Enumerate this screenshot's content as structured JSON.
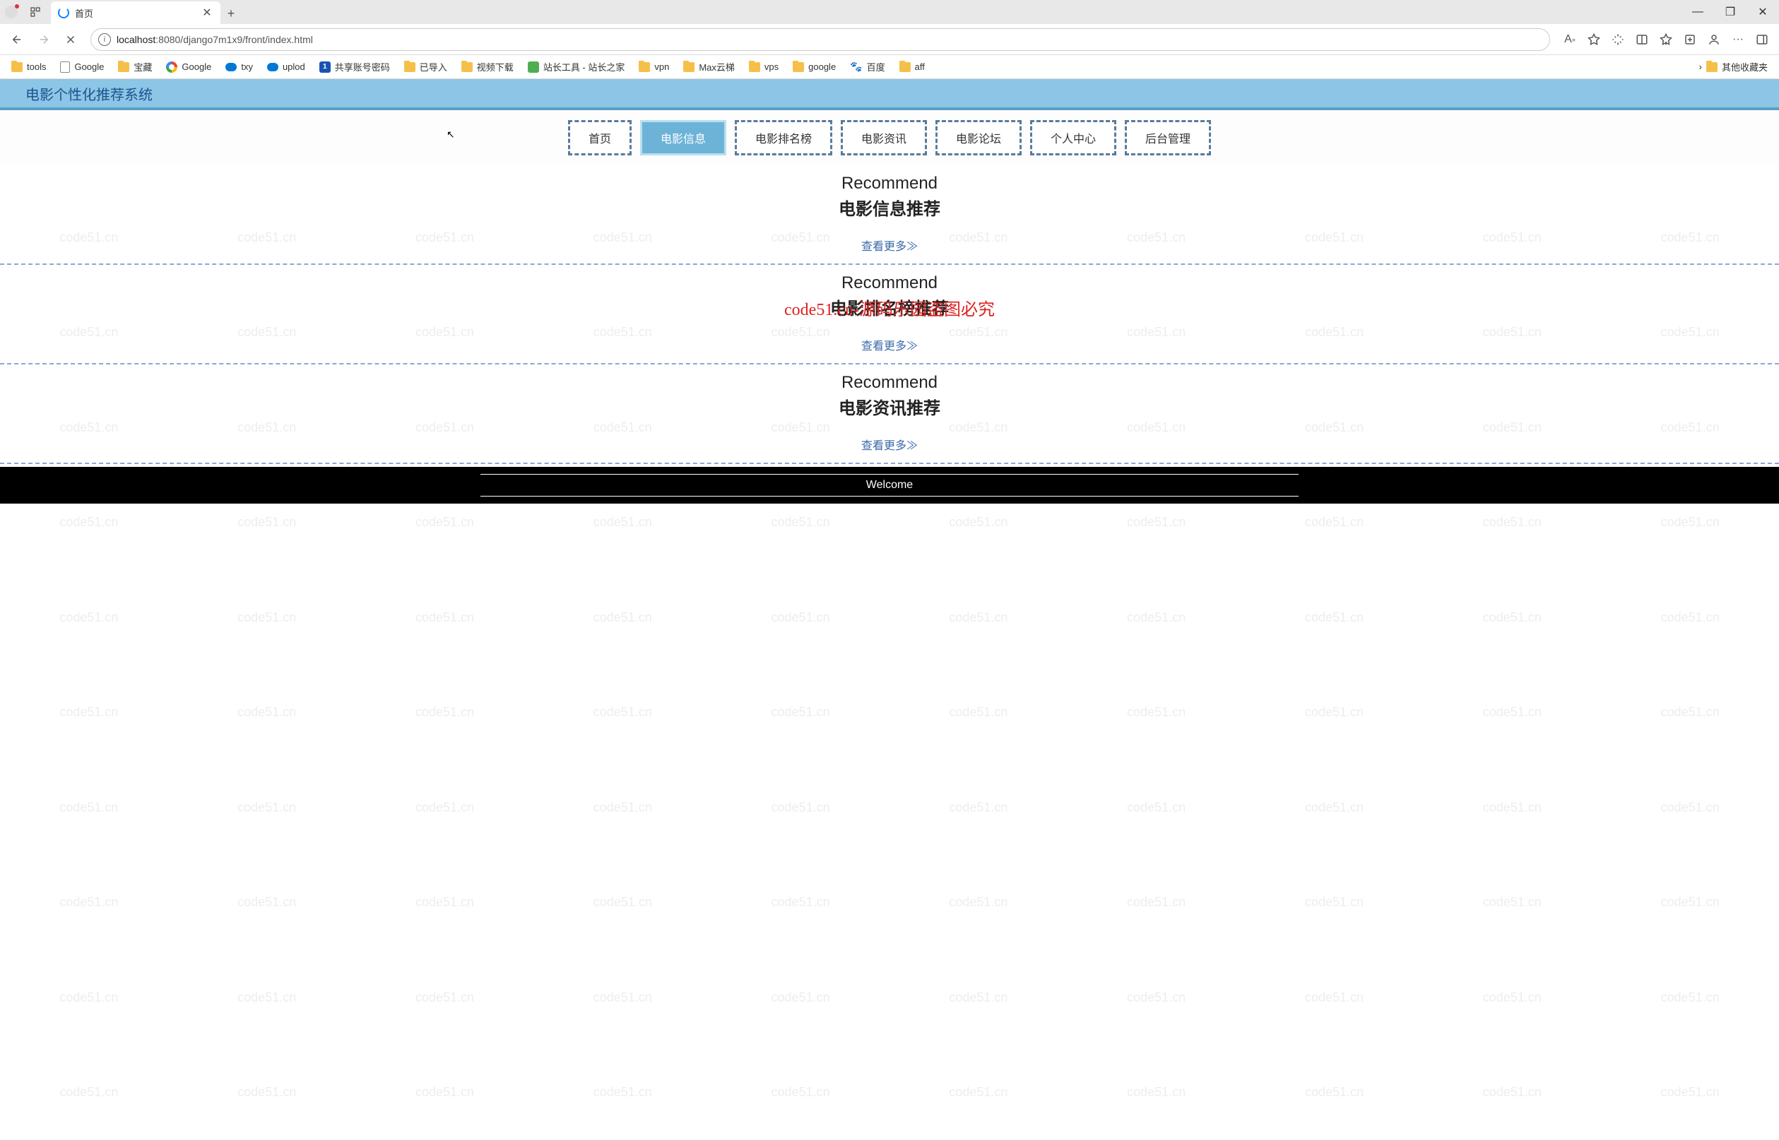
{
  "watermark": "code51.cn",
  "browser": {
    "tab_title": "首页",
    "url_host": "localhost",
    "url_path": ":8080/django7m1x9/front/index.html",
    "min": "—",
    "max": "❐",
    "close": "✕",
    "newtab": "+",
    "tabclose": "✕",
    "more": "···"
  },
  "bookmarks": [
    {
      "type": "folder",
      "label": "tools"
    },
    {
      "type": "page",
      "label": "Google"
    },
    {
      "type": "folder",
      "label": "宝藏"
    },
    {
      "type": "g",
      "label": "Google"
    },
    {
      "type": "onedrive",
      "label": "txy"
    },
    {
      "type": "onedrive",
      "label": "uplod"
    },
    {
      "type": "1pass",
      "label": "共享账号密码"
    },
    {
      "type": "folder",
      "label": "已导入"
    },
    {
      "type": "folder",
      "label": "视频下载"
    },
    {
      "type": "green",
      "label": "站长工具 - 站长之家"
    },
    {
      "type": "folder",
      "label": "vpn"
    },
    {
      "type": "folder",
      "label": "Max云梯"
    },
    {
      "type": "folder",
      "label": "vps"
    },
    {
      "type": "folder",
      "label": "google"
    },
    {
      "type": "paw",
      "label": "百度"
    },
    {
      "type": "folder",
      "label": "aff"
    }
  ],
  "bookmarks_overflow": "其他收藏夹",
  "header": {
    "title": "电影个性化推荐系统"
  },
  "nav": [
    {
      "label": "首页",
      "active": false
    },
    {
      "label": "电影信息",
      "active": true
    },
    {
      "label": "电影排名榜",
      "active": false
    },
    {
      "label": "电影资讯",
      "active": false
    },
    {
      "label": "电影论坛",
      "active": false
    },
    {
      "label": "个人中心",
      "active": false
    },
    {
      "label": "后台管理",
      "active": false
    }
  ],
  "sections": [
    {
      "en": "Recommend",
      "zh": "电影信息推荐",
      "more": "查看更多≫"
    },
    {
      "en": "Recommend",
      "zh": "电影排名榜推荐",
      "more": "查看更多≫"
    },
    {
      "en": "Recommend",
      "zh": "电影资讯推荐",
      "more": "查看更多≫"
    }
  ],
  "overlay": "code51.cn-源码乐园盗图必究",
  "footer": "Welcome"
}
